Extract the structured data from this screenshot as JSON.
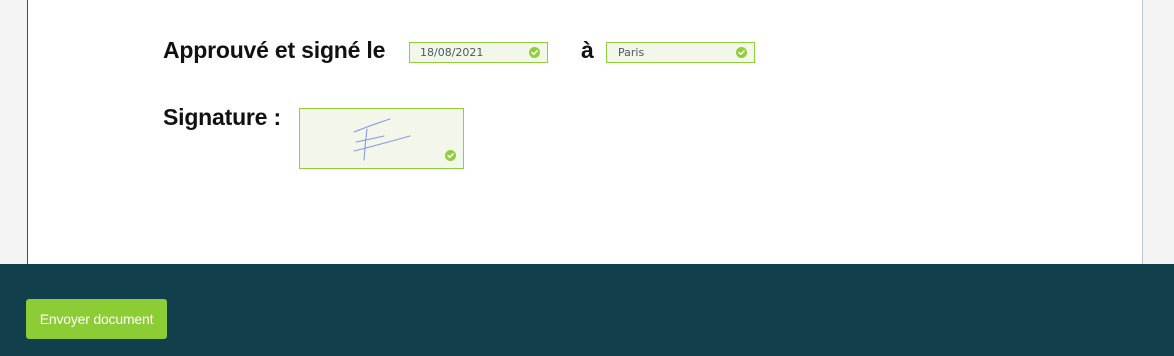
{
  "document": {
    "approval_label": "Approuvé et signé le",
    "date_value": "18/08/2021",
    "at_label": "à",
    "place_value": "Paris",
    "signature_label": "Signature :"
  },
  "footer": {
    "send_button_label": "Envoyer document"
  },
  "colors": {
    "valid_field_border": "#8fcf3e",
    "valid_field_background": "#f2f7ea",
    "footer_background": "#113f4c",
    "button_background": "#8ccc35",
    "signature_ink": "#8a9be8"
  },
  "icons": {
    "field_status": "check-circle-icon"
  }
}
